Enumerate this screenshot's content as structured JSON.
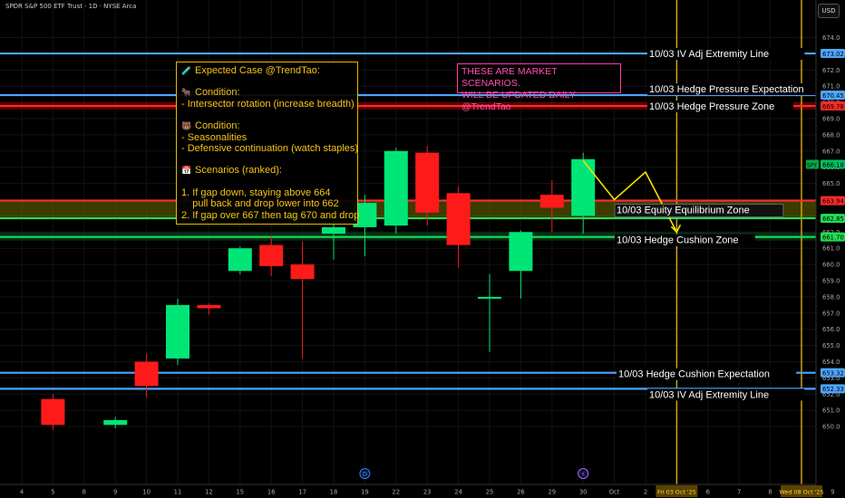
{
  "header": {
    "symbol_line": "SPDR S&P 500 ETF Trust · 1D · NYSE Arca",
    "currency_button": "USD"
  },
  "expected_case": {
    "title": "Expected Case @TrendTao:",
    "title_icon": "test-tube-icon",
    "condition1_label": "Condition:",
    "condition1_icon": "bull-icon",
    "condition1_text": "- Intersector rotation (increase breadth)",
    "condition2_label": "Condition:",
    "condition2_icon": "bear-icon",
    "condition2_line1": "- Seasonalities",
    "condition2_line2": "- Defensive continuation (watch staples)",
    "scenarios_label": "Scenarios (ranked):",
    "scenarios_icon": "calendar-icon",
    "scenario1_line1": "1. If gap down, staying above 664",
    "scenario1_line2": "    pull back and drop lower into 662",
    "scenario2_line1": "2. If gap over 667 then tag 670 and drop"
  },
  "scenario_note": {
    "line1": "THESE ARE MARKET SCENARIOS.",
    "line2": "WILL BE UPDATED DAILY @TrendTao"
  },
  "colors": {
    "background": "#000000",
    "bull": "#00e676",
    "bear": "#ff1a1a",
    "level_blue": "#4da6ff",
    "level_red": "#ff2a2a",
    "level_green": "#22dd55",
    "event_vline": "#d4a017",
    "annotation_yellow": "#f5c518",
    "note_pink": "#ff4fb0"
  },
  "chart_data": {
    "type": "candlestick",
    "x_tick_labels": [
      "4",
      "5",
      "8",
      "9",
      "10",
      "11",
      "12",
      "15",
      "16",
      "17",
      "18",
      "19",
      "22",
      "23",
      "24",
      "25",
      "26",
      "29",
      "30",
      "Oct",
      "2",
      "Fri 03 Oct '25",
      "6",
      "7",
      "8",
      "Wed 08 Oct '25",
      "9"
    ],
    "y_ticks": [
      650,
      651,
      652,
      653,
      654,
      655,
      656,
      657,
      658,
      659,
      660,
      661,
      662,
      663,
      664,
      665,
      666,
      667,
      668,
      669,
      670,
      671,
      672,
      673,
      674
    ],
    "ylim": [
      649.5,
      675.5
    ],
    "candles": [
      {
        "date": "5",
        "o": 651.7,
        "h": 652.0,
        "l": 649.8,
        "c": 650.1
      },
      {
        "date": "9",
        "o": 650.1,
        "h": 650.6,
        "l": 649.9,
        "c": 650.4
      },
      {
        "date": "10",
        "o": 654.0,
        "h": 654.5,
        "l": 651.8,
        "c": 652.5
      },
      {
        "date": "11",
        "o": 654.2,
        "h": 657.9,
        "l": 653.8,
        "c": 657.5
      },
      {
        "date": "12",
        "o": 657.5,
        "h": 657.6,
        "l": 656.9,
        "c": 657.3
      },
      {
        "date": "15",
        "o": 659.6,
        "h": 661.1,
        "l": 659.4,
        "c": 661.0
      },
      {
        "date": "16",
        "o": 661.2,
        "h": 661.8,
        "l": 659.3,
        "c": 659.9
      },
      {
        "date": "17",
        "o": 660.0,
        "h": 661.4,
        "l": 654.2,
        "c": 659.1
      },
      {
        "date": "18",
        "o": 661.9,
        "h": 663.1,
        "l": 660.3,
        "c": 662.3
      },
      {
        "date": "19",
        "o": 662.3,
        "h": 664.3,
        "l": 660.5,
        "c": 663.8
      },
      {
        "date": "22",
        "o": 662.4,
        "h": 667.2,
        "l": 661.9,
        "c": 667.0
      },
      {
        "date": "23",
        "o": 666.9,
        "h": 667.3,
        "l": 662.4,
        "c": 663.2
      },
      {
        "date": "24",
        "o": 664.4,
        "h": 664.8,
        "l": 659.8,
        "c": 661.2
      },
      {
        "date": "25",
        "o": 658.0,
        "h": 659.4,
        "l": 654.6,
        "c": 658.0
      },
      {
        "date": "26",
        "o": 659.6,
        "h": 662.1,
        "l": 657.9,
        "c": 662.0
      },
      {
        "date": "29",
        "o": 664.3,
        "h": 665.2,
        "l": 662.0,
        "c": 663.5
      },
      {
        "date": "30",
        "o": 663.0,
        "h": 666.9,
        "l": 661.9,
        "c": 666.5
      }
    ],
    "levels": [
      {
        "label": "10/03 IV Adj Extremity Line",
        "price": 673.02,
        "price_label": "673.02",
        "color": "#4da6ff",
        "label_style": "plain"
      },
      {
        "label": "10/03 Hedge Pressure Expectation",
        "price": 670.45,
        "price_label": "670.45",
        "color": "#4da6ff",
        "label_style": "plain"
      },
      {
        "label": "10/03 Hedge Pressure Zone",
        "price": 669.78,
        "price_label": "669.78",
        "color": "#ff2a2a",
        "label_style": "plain"
      },
      {
        "label": "10/03 Equity Equilibrium Zone",
        "price": 663.94,
        "price_label": "663.94",
        "color": "#ff2a2a",
        "label_style": "boxed"
      },
      {
        "label": "",
        "price": 662.85,
        "price_label": "662.85",
        "color": "#22dd55",
        "label_style": "none"
      },
      {
        "label": "10/03 Hedge Cushion Zone",
        "price": 661.7,
        "price_label": "661.70",
        "color": "#22dd55",
        "label_style": "plain"
      },
      {
        "label": "10/03 Hedge Cushion Expectation",
        "price": 653.32,
        "price_label": "653.32",
        "color": "#4da6ff",
        "label_style": "plain"
      },
      {
        "label": "10/03 IV Adj Extremity Line",
        "price": 652.33,
        "price_label": "652.33",
        "color": "#4da6ff",
        "label_style": "plain"
      }
    ],
    "last_price": {
      "label": "SPY",
      "value": "666.18",
      "price": 666.18
    },
    "projection_path": [
      {
        "x_date": "30",
        "price": 666.4
      },
      {
        "x_date": "1",
        "price": 664.0
      },
      {
        "x_date": "2",
        "price": 665.7
      },
      {
        "x_date": "Fri 03 Oct '25",
        "price": 662.0
      }
    ],
    "event_markers": [
      {
        "date": "19",
        "glyph": "D"
      },
      {
        "date": "30",
        "glyph": "⚡"
      }
    ],
    "vertical_lines": [
      "Fri 03 Oct '25",
      "Wed 08 Oct '25"
    ]
  }
}
